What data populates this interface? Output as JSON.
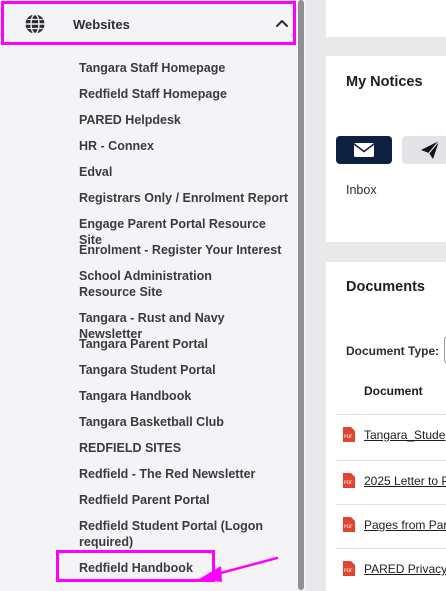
{
  "sidebar": {
    "section_title": "Websites",
    "links": [
      "Tangara Staff Homepage",
      "Redfield Staff Homepage",
      "PARED Helpdesk",
      "HR - Connex",
      "Edval",
      "Registrars Only / Enrolment Report",
      "Engage Parent Portal Resource Site",
      "Enrolment - Register Your Interest",
      "School Administration Resource Site",
      "Tangara - Rust and Navy Newsletter",
      "Tangara Parent Portal",
      "Tangara Student Portal",
      "Tangara Handbook",
      "Tangara Basketball Club",
      "REDFIELD SITES",
      "Redfield - The Red Newsletter",
      "Redfield Parent Portal",
      "Redfield Student Portal (Logon required)",
      "Redfield Handbook"
    ],
    "highlighted_link": "Redfield Handbook"
  },
  "notices": {
    "title": "My Notices",
    "inbox_label": "Inbox"
  },
  "documents": {
    "title": "Documents",
    "doc_type_label": "Document Type:",
    "column_header": "Document",
    "rows": [
      "Tangara_Stude",
      "2025 Letter to P",
      "Pages from Par",
      "PARED Privacy"
    ]
  },
  "colors": {
    "annotation": "#ff00ff",
    "inbox_button": "#0e2040",
    "pdf_icon": "#e0442e"
  },
  "icons": [
    "globe-icon",
    "chevron-up-icon",
    "envelope-icon",
    "paper-plane-icon",
    "pdf-icon"
  ]
}
